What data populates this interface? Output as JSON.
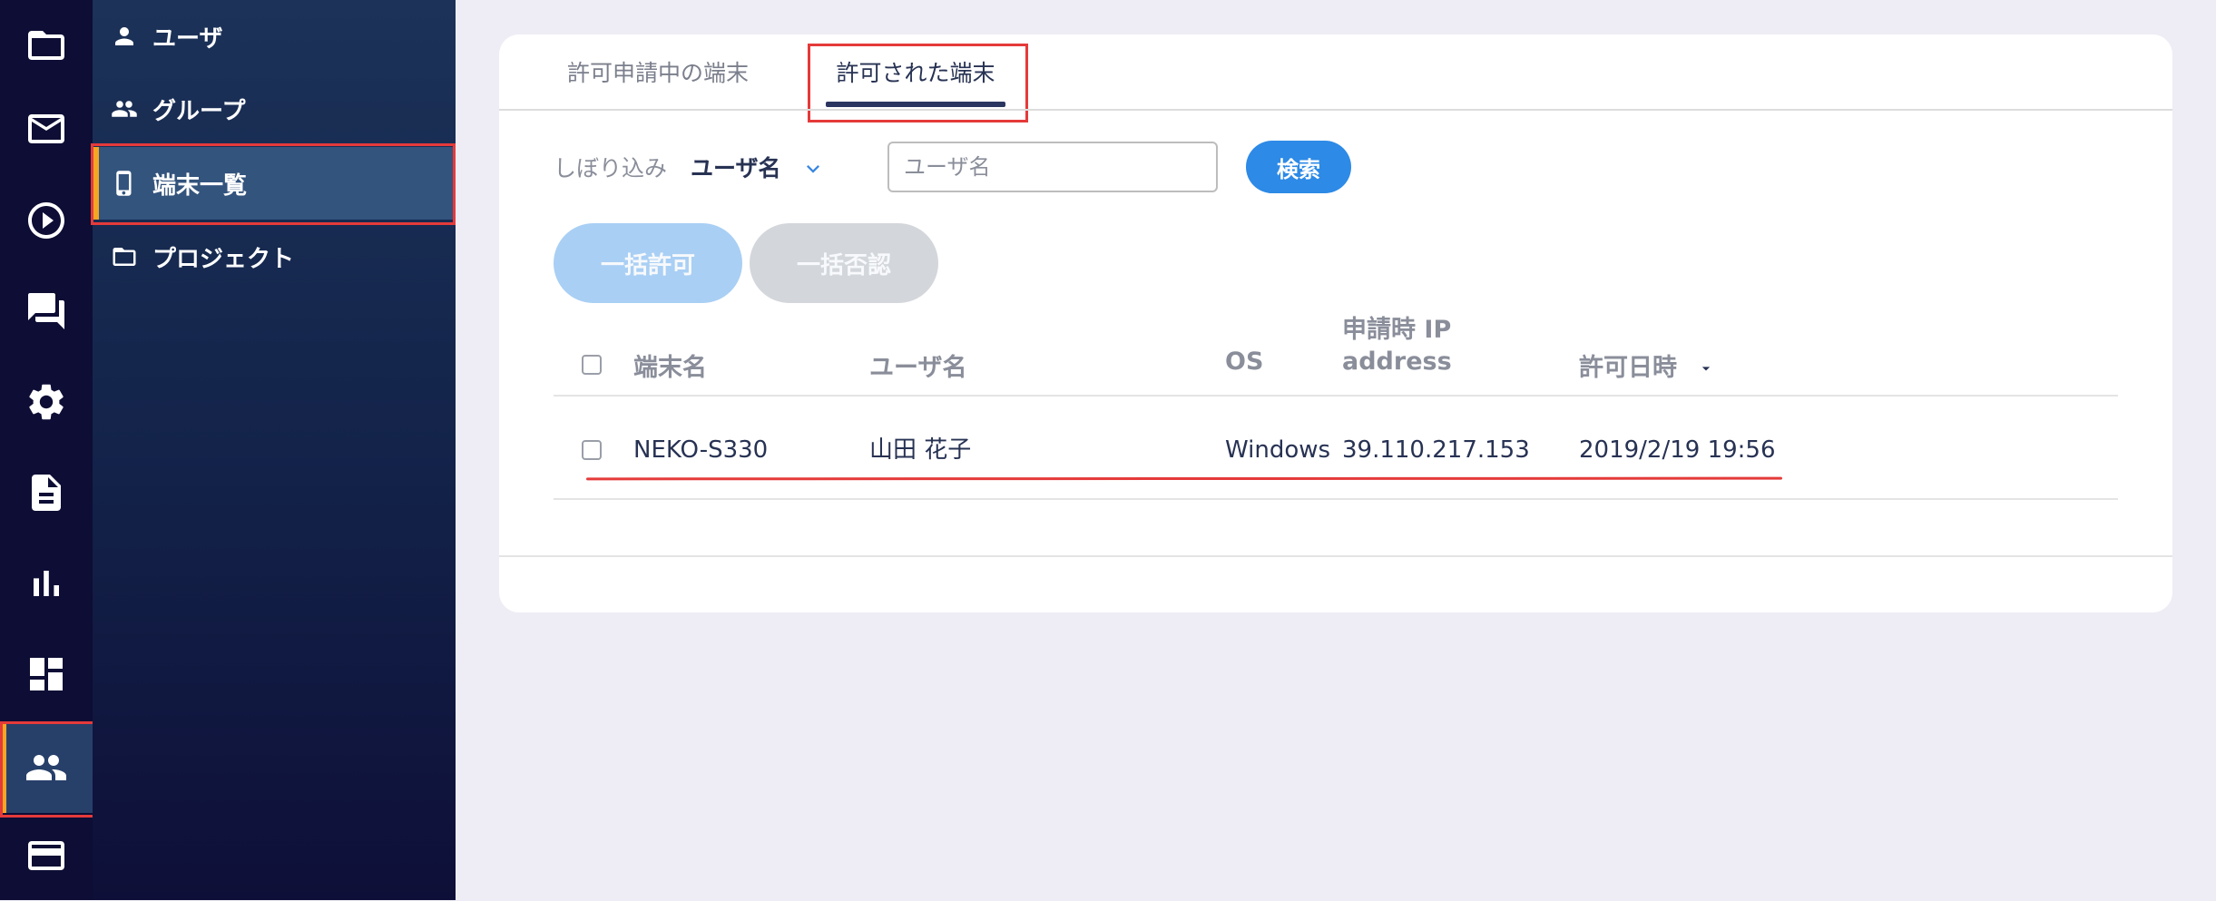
{
  "rail": {
    "items": [
      {
        "icon": "folder-icon"
      },
      {
        "icon": "mail-icon"
      },
      {
        "icon": "play-circle-icon"
      },
      {
        "icon": "chat-icon"
      },
      {
        "icon": "gear-icon"
      },
      {
        "icon": "document-icon"
      },
      {
        "icon": "bar-chart-icon"
      },
      {
        "icon": "dashboard-icon"
      },
      {
        "icon": "people-icon",
        "active": true
      },
      {
        "icon": "credit-card-icon"
      }
    ]
  },
  "menu": {
    "items": [
      {
        "label": "ユーザ",
        "icon": "person-icon"
      },
      {
        "label": "グループ",
        "icon": "group-icon"
      },
      {
        "label": "端末一覧",
        "icon": "smartphone-icon",
        "active": true
      },
      {
        "label": "プロジェクト",
        "icon": "folder-outline-icon"
      }
    ]
  },
  "tabs": [
    {
      "label": "許可申請中の端末",
      "active": false
    },
    {
      "label": "許可された端末",
      "active": true
    }
  ],
  "filter": {
    "label": "しぼり込み",
    "field_selected": "ユーザ名",
    "input_value": "",
    "input_placeholder": "ユーザ名",
    "search_label": "検索"
  },
  "bulk_actions": {
    "approve_label": "一括許可",
    "deny_label": "一括否認"
  },
  "table": {
    "columns": {
      "device": "端末名",
      "user": "ユーザ名",
      "os": "OS",
      "ip_line1": "申請時 IP",
      "ip_line2": "address",
      "date": "許可日時"
    },
    "sort_icon": "caret-down-icon",
    "rows": [
      {
        "checked": false,
        "device": "NEKO-S330",
        "user": "山田 花子",
        "os": "Windows",
        "ip": "39.110.217.153",
        "date": "2019/2/19 19:56"
      }
    ]
  },
  "colors": {
    "rail_bg": "#0d0d35",
    "active_accent": "#f5a623",
    "primary_button": "#2d8ae6",
    "highlight_red": "#e53a3a"
  }
}
